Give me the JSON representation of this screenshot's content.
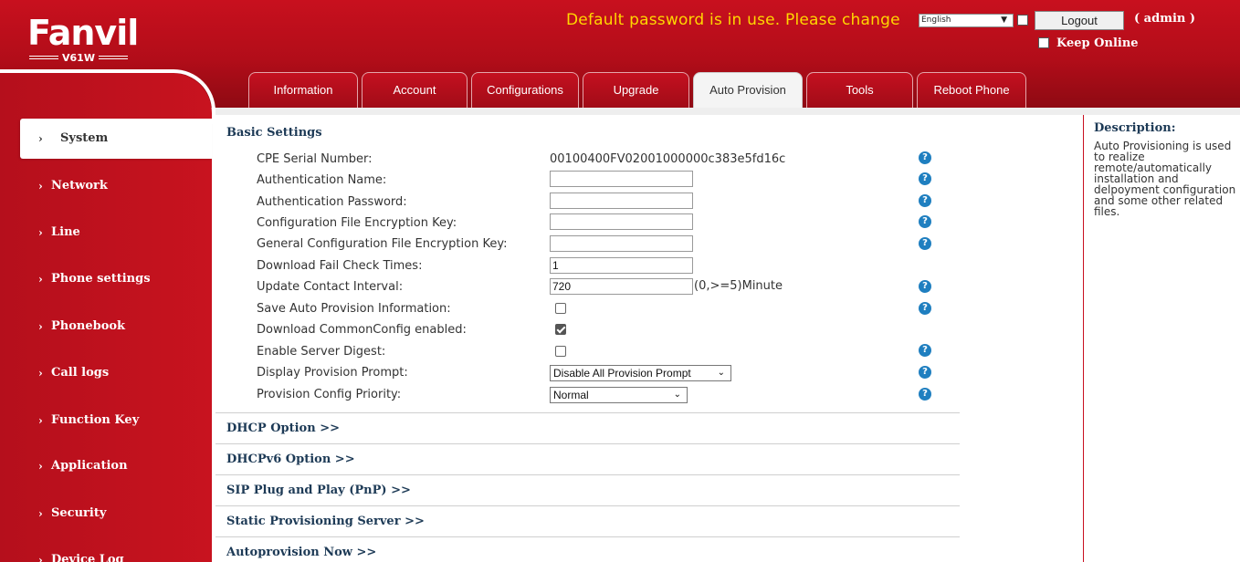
{
  "header": {
    "logo_text": "Fanvil",
    "model": "V61W",
    "password_warning": "Default password is in use. Please change",
    "language": {
      "selected": "English",
      "options_visible": [
        "English"
      ]
    },
    "logout_label": "Logout",
    "user_label": "( admin )",
    "keep_online_label": "Keep Online",
    "colors": {
      "brand_red": "#c8101e",
      "warning_yellow": "#ffd700",
      "help_blue": "#1f7fc0"
    }
  },
  "tabs": [
    {
      "label": "Information",
      "active": false
    },
    {
      "label": "Account",
      "active": false
    },
    {
      "label": "Configurations",
      "active": false
    },
    {
      "label": "Upgrade",
      "active": false
    },
    {
      "label": "Auto Provision",
      "active": true
    },
    {
      "label": "Tools",
      "active": false
    },
    {
      "label": "Reboot Phone",
      "active": false
    }
  ],
  "sidebar": {
    "arrow_glyph": "›",
    "items": [
      {
        "label": "System",
        "active": true
      },
      {
        "label": "Network",
        "active": false
      },
      {
        "label": "Line",
        "active": false
      },
      {
        "label": "Phone settings",
        "active": false
      },
      {
        "label": "Phonebook",
        "active": false
      },
      {
        "label": "Call logs",
        "active": false
      },
      {
        "label": "Function Key",
        "active": false
      },
      {
        "label": "Application",
        "active": false
      },
      {
        "label": "Security",
        "active": false
      },
      {
        "label": "Device Log",
        "active": false
      }
    ]
  },
  "basic_settings": {
    "title": "Basic Settings",
    "help_glyph": "?",
    "cpe_serial": {
      "label": "CPE Serial Number:",
      "value": "00100400FV02001000000c383e5fd16c"
    },
    "auth_name": {
      "label": "Authentication Name:",
      "value": ""
    },
    "auth_password": {
      "label": "Authentication Password:",
      "value": ""
    },
    "config_key": {
      "label": "Configuration File Encryption Key:",
      "value": ""
    },
    "general_key": {
      "label": "General Configuration File Encryption Key:",
      "value": ""
    },
    "fail_check": {
      "label": "Download Fail Check Times:",
      "value": "1"
    },
    "update_interval": {
      "label": "Update Contact Interval:",
      "value": "720",
      "unit": "(0,>=5)Minute"
    },
    "save_info": {
      "label": "Save Auto Provision Information:",
      "checked": false
    },
    "common_config": {
      "label": "Download CommonConfig enabled:",
      "checked": true
    },
    "server_digest": {
      "label": "Enable Server Digest:",
      "checked": false
    },
    "display_prompt": {
      "label": "Display Provision Prompt:",
      "selected": "Disable All Provision Prompt"
    },
    "priority": {
      "label": "Provision Config Priority:",
      "selected": "Normal"
    }
  },
  "sections": [
    {
      "label": "DHCP Option >>"
    },
    {
      "label": "DHCPv6 Option >>"
    },
    {
      "label": "SIP Plug and Play (PnP) >>"
    },
    {
      "label": "Static Provisioning Server >>"
    },
    {
      "label": "Autoprovision Now >>"
    }
  ],
  "description": {
    "title": "Description:",
    "lines": [
      "Auto Provisioning is used",
      "to realize",
      "remote/automatically",
      "installation and",
      "delpoyment configuration",
      "and some other related",
      "files."
    ]
  }
}
